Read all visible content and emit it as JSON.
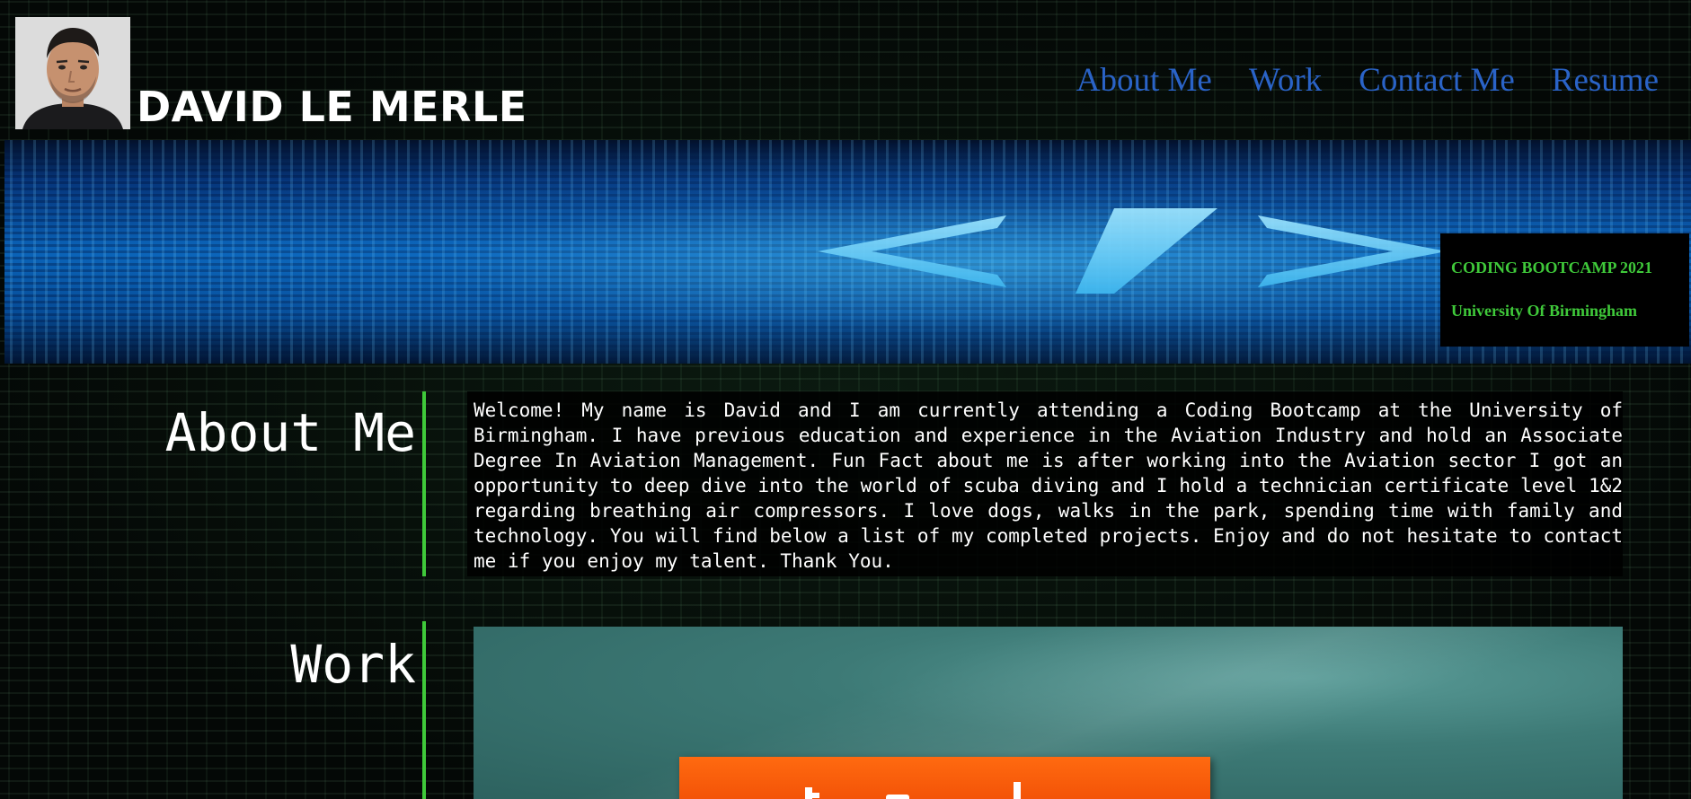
{
  "header": {
    "site_title": "DAVID LE MERLE",
    "avatar_alt": "David Le Merle profile photo",
    "nav": [
      {
        "label": "About Me"
      },
      {
        "label": "Work"
      },
      {
        "label": "Contact Me"
      },
      {
        "label": "Resume"
      }
    ]
  },
  "banner": {
    "symbol": "code-brackets-icon",
    "bootcamp": {
      "title": "CODING BOOTCAMP 2021",
      "institution": "University Of Birmingham"
    }
  },
  "about": {
    "heading": "About Me",
    "text": "Welcome! My name is David and I am currently attending a Coding Bootcamp at the University of Birmingham. I have previous education and experience in the Aviation Industry and hold an Associate Degree In Aviation Management. Fun Fact about me is after working into the Aviation sector I got an opportunity to deep dive into the world of scuba diving and I hold a technician certificate level 1&2 regarding breathing air compressors. I love dogs, walks in the park, spending time with family and technology. You will find below a list of my completed projects. Enjoy and do not hesitate to contact me if you enjoy my talent. Thank You."
  },
  "work": {
    "heading": "Work"
  },
  "colors": {
    "accent_green": "#3fc93a",
    "nav_blue": "#2a63c7",
    "background": "#040806"
  }
}
